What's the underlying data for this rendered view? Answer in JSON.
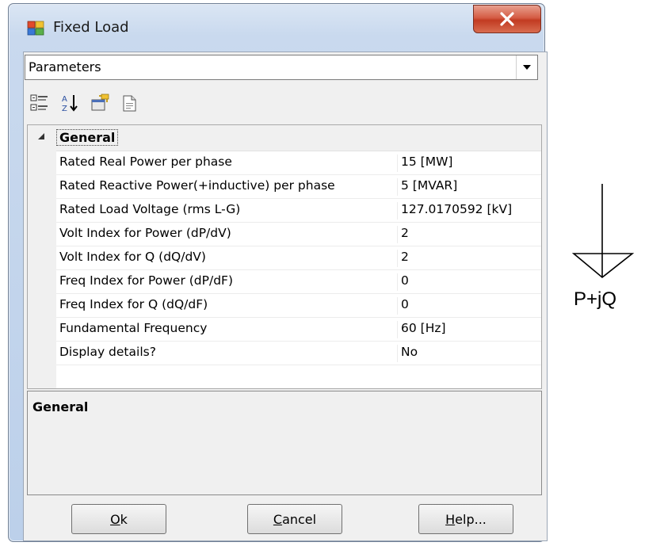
{
  "window": {
    "title": "Fixed Load",
    "close_glyph": "X"
  },
  "combo": {
    "selected": "Parameters"
  },
  "toolbar": {
    "icons": [
      "categorized-view-icon",
      "alphabetical-sort-icon",
      "property-pages-icon",
      "export-icon"
    ]
  },
  "grid": {
    "category": "General",
    "rows": [
      {
        "name": "Rated Real Power per phase",
        "value": "15 [MW]"
      },
      {
        "name": "Rated Reactive Power(+inductive) per phase",
        "value": "5 [MVAR]"
      },
      {
        "name": "Rated Load Voltage (rms L-G)",
        "value": "127.0170592 [kV]"
      },
      {
        "name": "Volt Index for Power (dP/dV)",
        "value": "2"
      },
      {
        "name": "Volt Index for Q (dQ/dV)",
        "value": "2"
      },
      {
        "name": "Freq Index for Power (dP/dF)",
        "value": "0"
      },
      {
        "name": "Freq Index for Q (dQ/dF)",
        "value": "0"
      },
      {
        "name": "Fundamental Frequency",
        "value": "60 [Hz]"
      },
      {
        "name": "Display details?",
        "value": "No"
      }
    ]
  },
  "help_pane": {
    "title": "General"
  },
  "buttons": {
    "ok": {
      "mnemonic": "O",
      "rest": "k"
    },
    "cancel": {
      "mnemonic": "C",
      "rest": "ancel"
    },
    "help": {
      "mnemonic": "H",
      "rest": "elp..."
    }
  },
  "symbol": {
    "label": "P+jQ"
  }
}
